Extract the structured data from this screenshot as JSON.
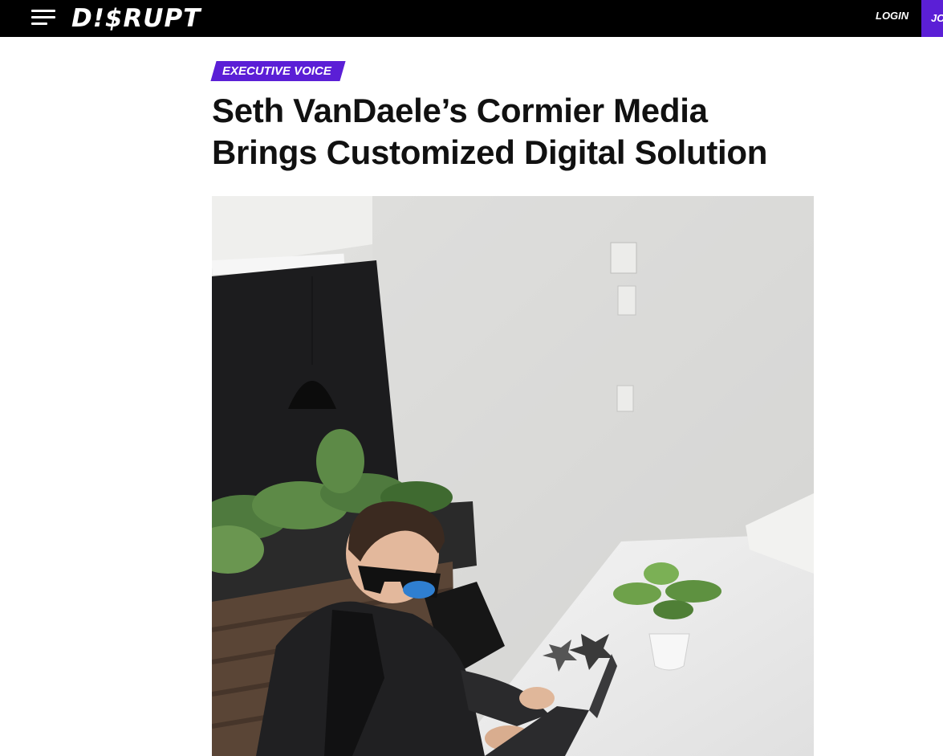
{
  "header": {
    "brand": "D!$RUPT",
    "login_label": "LOGIN",
    "join_label": "JO",
    "menu_icon": "hamburger-menu-icon"
  },
  "article": {
    "category": "EXECUTIVE VOICE",
    "title_line1": "Seth VanDaele’s Cormier Media",
    "title_line2": "Brings Customized Digital Solution"
  },
  "colors": {
    "accent": "#5b1fd6",
    "topbar": "#000000",
    "text": "#111111"
  }
}
